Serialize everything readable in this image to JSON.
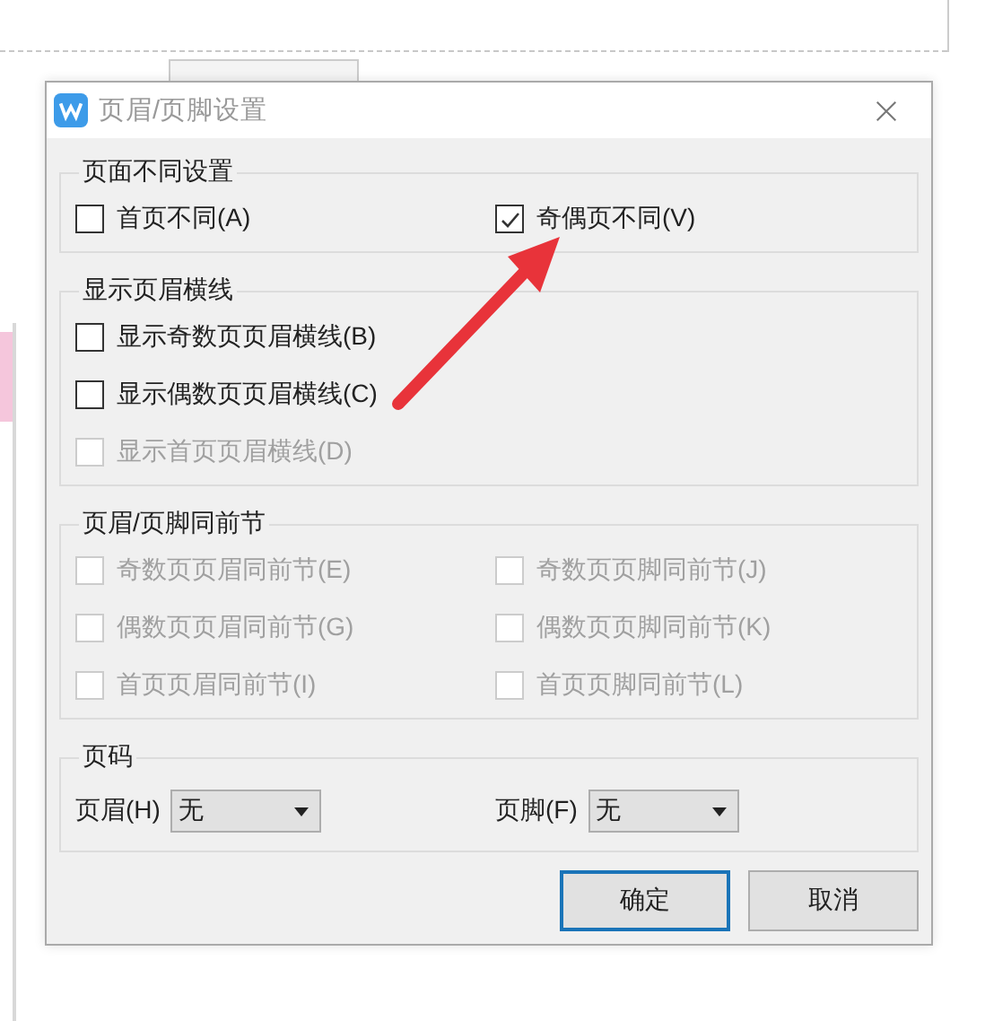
{
  "dialog": {
    "title": "页眉/页脚设置",
    "groups": [
      {
        "title": "页面不同设置",
        "kind": "two-column",
        "options": [
          {
            "label": "首页不同(A)",
            "checked": false,
            "disabled": false
          },
          {
            "label": "奇偶页不同(V)",
            "checked": true,
            "disabled": false
          }
        ]
      },
      {
        "title": "显示页眉横线",
        "kind": "one-column",
        "options": [
          {
            "label": "显示奇数页页眉横线(B)",
            "checked": false,
            "disabled": false
          },
          {
            "label": "显示偶数页页眉横线(C)",
            "checked": false,
            "disabled": false
          },
          {
            "label": "显示首页页眉横线(D)",
            "checked": false,
            "disabled": true
          }
        ]
      },
      {
        "title": "页眉/页脚同前节",
        "kind": "two-column",
        "options": [
          {
            "label": "奇数页页眉同前节(E)",
            "checked": false,
            "disabled": true
          },
          {
            "label": "奇数页页脚同前节(J)",
            "checked": false,
            "disabled": true
          },
          {
            "label": "偶数页页眉同前节(G)",
            "checked": false,
            "disabled": true
          },
          {
            "label": "偶数页页脚同前节(K)",
            "checked": false,
            "disabled": true
          },
          {
            "label": "首页页眉同前节(I)",
            "checked": false,
            "disabled": true
          },
          {
            "label": "首页页脚同前节(L)",
            "checked": false,
            "disabled": true
          }
        ]
      },
      {
        "title": "页码",
        "kind": "selects",
        "fields": [
          {
            "label": "页眉(H)",
            "value": "无"
          },
          {
            "label": "页脚(F)",
            "value": "无"
          }
        ]
      }
    ],
    "buttons": [
      {
        "label": "确定",
        "default": true
      },
      {
        "label": "取消",
        "default": false
      }
    ]
  }
}
